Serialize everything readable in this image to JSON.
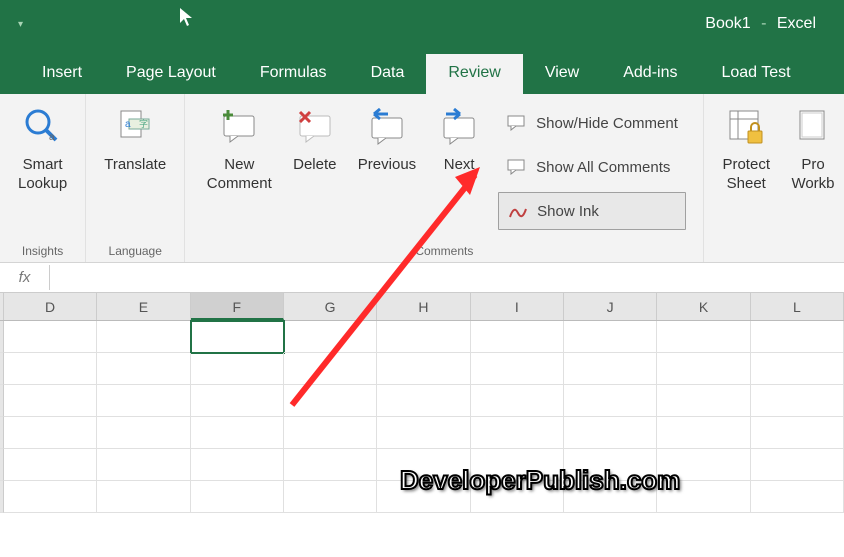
{
  "title": {
    "book": "Book1",
    "sep": "-",
    "app": "Excel"
  },
  "tabs": [
    {
      "label": "Insert"
    },
    {
      "label": "Page Layout"
    },
    {
      "label": "Formulas"
    },
    {
      "label": "Data"
    },
    {
      "label": "Review",
      "active": true
    },
    {
      "label": "View"
    },
    {
      "label": "Add-ins"
    },
    {
      "label": "Load Test"
    }
  ],
  "ribbon": {
    "insights": {
      "smart": "Smart",
      "lookup": "Lookup",
      "group": "Insights"
    },
    "language": {
      "translate": "Translate",
      "group": "Language"
    },
    "comments": {
      "new1": "New",
      "new2": "Comment",
      "delete": "Delete",
      "previous": "Previous",
      "next": "Next",
      "showhide": "Show/Hide Comment",
      "showall": "Show All Comments",
      "showink": "Show Ink",
      "group": "Comments"
    },
    "protect": {
      "sheet1": "Protect",
      "sheet2": "Sheet",
      "wb1": "Pro",
      "wb2": "Workb"
    }
  },
  "fx": {
    "label": "fx",
    "value": ""
  },
  "columns": [
    "D",
    "E",
    "F",
    "G",
    "H",
    "I",
    "J",
    "K",
    "L"
  ],
  "active_col": "F",
  "watermark": "DeveloperPublish.com"
}
